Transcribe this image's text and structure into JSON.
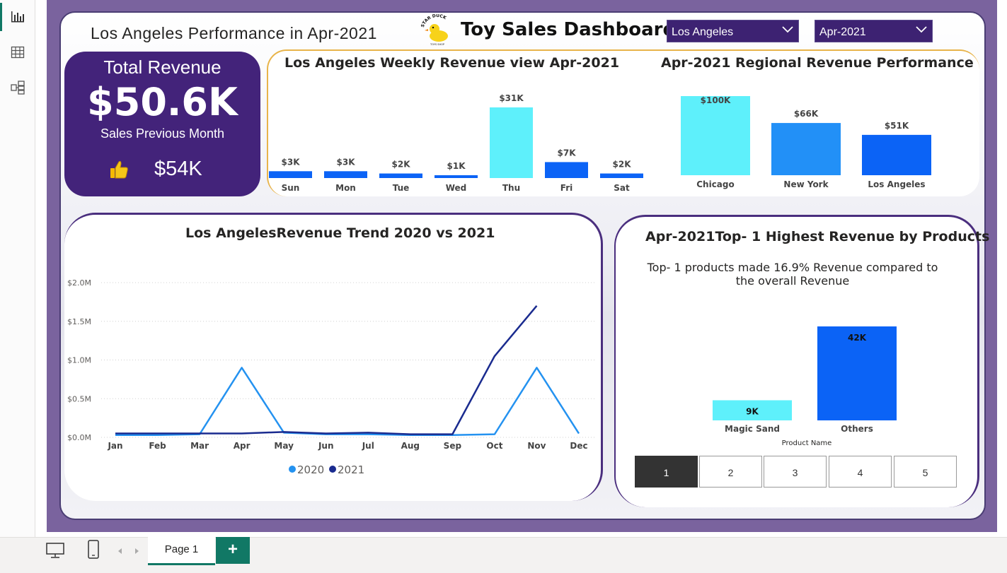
{
  "report": {
    "page_title": "Los Angeles Performance in Apr-2021",
    "dashboard_title": "Toy Sales Dashboard",
    "logo_text": "STAR DUCK TOYS SHOP"
  },
  "slicers": {
    "city": "Los Angeles",
    "month": "Apr-2021"
  },
  "kpi": {
    "label": "Total Revenue",
    "value": "$50.6K",
    "prev_label": "Sales Previous Month",
    "prev_value": "$54K"
  },
  "weekly": {
    "title": "Los Angeles Weekly Revenue view Apr-2021",
    "chart_data": {
      "type": "bar",
      "categories": [
        "Sun",
        "Mon",
        "Tue",
        "Wed",
        "Thu",
        "Fri",
        "Sat"
      ],
      "values": [
        3,
        3,
        2,
        1,
        31,
        7,
        2
      ],
      "labels": [
        "$3K",
        "$3K",
        "$2K",
        "$1K",
        "$31K",
        "$7K",
        "$2K"
      ],
      "highlight_index": 4,
      "colors": {
        "base": "#0b63f6",
        "highlight": "#5ef0fb"
      }
    }
  },
  "regional": {
    "title": "Apr-2021 Regional Revenue Performance",
    "chart_data": {
      "type": "bar",
      "categories": [
        "Chicago",
        "New York",
        "Los Angeles"
      ],
      "values": [
        100,
        66,
        51
      ],
      "labels": [
        "$100K",
        "$66K",
        "$51K"
      ],
      "colors": [
        "#5ef0fb",
        "#2290f7",
        "#0b63f6"
      ]
    }
  },
  "trend": {
    "title": "Los AngelesRevenue Trend 2020 vs 2021",
    "chart_data": {
      "type": "line",
      "x": [
        "Jan",
        "Feb",
        "Mar",
        "Apr",
        "May",
        "Jun",
        "Jul",
        "Aug",
        "Sep",
        "Oct",
        "Nov",
        "Dec"
      ],
      "y_ticks": [
        "$0.0M",
        "$0.5M",
        "$1.0M",
        "$1.5M",
        "$2.0M"
      ],
      "ylim": [
        0,
        2.0
      ],
      "grid": true,
      "legend_position": "bottom",
      "series": [
        {
          "name": "2020",
          "color": "#2492f0",
          "values": [
            0.03,
            0.03,
            0.04,
            0.9,
            0.06,
            0.04,
            0.04,
            0.03,
            0.03,
            0.04,
            0.9,
            0.05
          ]
        },
        {
          "name": "2021",
          "color": "#1a2b8f",
          "values": [
            0.05,
            0.05,
            0.05,
            0.05,
            0.07,
            0.05,
            0.06,
            0.04,
            0.04,
            1.05,
            1.7,
            null
          ]
        }
      ]
    }
  },
  "products": {
    "title": "Apr-2021Top- 1 Highest Revenue by Products",
    "subtitle": "Top- 1 products made 16.9% Revenue compared to the overall Revenue",
    "xlabel": "Product Name",
    "chart_data": {
      "type": "bar",
      "categories": [
        "Magic Sand",
        "Others"
      ],
      "values": [
        9,
        42
      ],
      "labels": [
        "9K",
        "42K"
      ],
      "colors": [
        "#5ef0fb",
        "#0b63f6"
      ]
    },
    "pager": [
      "1",
      "2",
      "3",
      "4",
      "5"
    ],
    "pager_selected": "1"
  },
  "footer": {
    "page_tab": "Page 1",
    "add_tab": "+"
  }
}
